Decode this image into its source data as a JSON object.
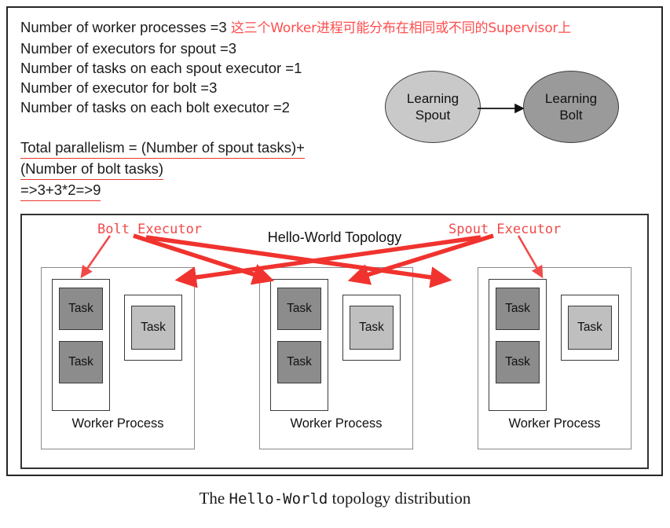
{
  "spec": {
    "lines": [
      {
        "text": "Number of worker processes =3",
        "note": "这三个Worker进程可能分布在相同或不同的Supervisor上"
      },
      {
        "text": "Number of executors for spout =3",
        "note": ""
      },
      {
        "text": "Number of tasks on each spout executor =1",
        "note": ""
      },
      {
        "text": "Number of executor for bolt =3",
        "note": ""
      },
      {
        "text": "Number of tasks on each bolt executor =2",
        "note": ""
      }
    ]
  },
  "formula": {
    "line1": "Total parallelism =  (Number of spout tasks)+",
    "line2": "(Number of bolt tasks)",
    "line3": "=>3+3*2=>9",
    "underline_color": "#e8382f"
  },
  "flow": {
    "spout": {
      "label": "Learning\nSpout",
      "line1": "Learning",
      "line2": "Spout",
      "fill": "#c9c9c9"
    },
    "bolt": {
      "label": "Learning\nBolt",
      "line1": "Learning",
      "line2": "Bolt",
      "fill": "#9a9a9a"
    },
    "arrow": "spout-to-bolt-arrow"
  },
  "topology": {
    "title": "Hello-World Topology",
    "annotations": {
      "bolt_executor": "Bolt Executor",
      "spout_executor": "Spout Executor",
      "color": "#f04a4a"
    },
    "workers": [
      {
        "label": "Worker Process",
        "bolt_executor": {
          "tasks": [
            "Task",
            "Task"
          ],
          "fill": "#8c8c8c"
        },
        "spout_executor": {
          "tasks": [
            "Task"
          ],
          "fill": "#bfbfbf"
        }
      },
      {
        "label": "Worker Process",
        "bolt_executor": {
          "tasks": [
            "Task",
            "Task"
          ],
          "fill": "#8c8c8c"
        },
        "spout_executor": {
          "tasks": [
            "Task"
          ],
          "fill": "#bfbfbf"
        }
      },
      {
        "label": "Worker Process",
        "bolt_executor": {
          "tasks": [
            "Task",
            "Task"
          ],
          "fill": "#8c8c8c"
        },
        "spout_executor": {
          "tasks": [
            "Task"
          ],
          "fill": "#bfbfbf"
        }
      }
    ]
  },
  "caption": {
    "before": "The ",
    "mono": "Hello-World",
    "after": " topology distribution"
  }
}
